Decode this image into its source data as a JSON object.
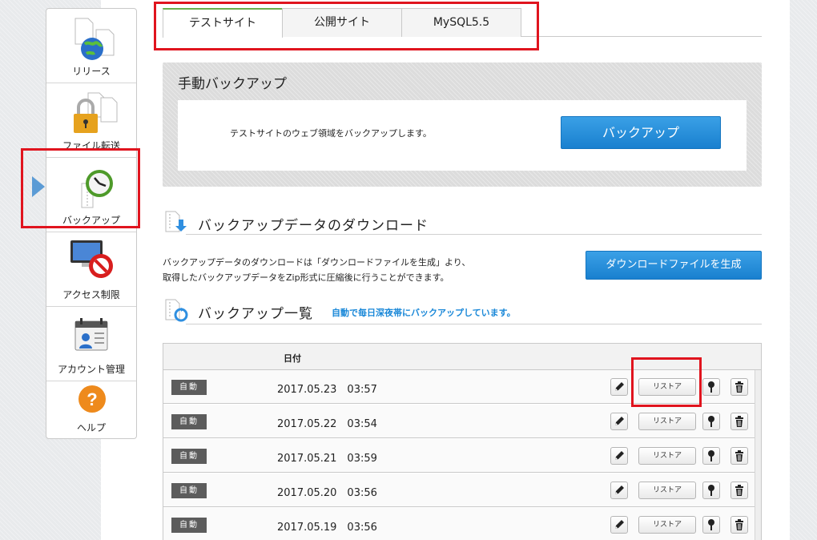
{
  "sidebar": {
    "items": [
      {
        "label": "リリース",
        "icon": "release-globe-icon"
      },
      {
        "label": "ファイル転送",
        "icon": "lock-files-icon"
      },
      {
        "label": "バックアップ",
        "icon": "clock-backup-icon"
      },
      {
        "label": "アクセス制限",
        "icon": "monitor-no-entry-icon"
      },
      {
        "label": "アカウント管理",
        "icon": "calendar-account-icon"
      },
      {
        "label": "ヘルプ",
        "icon": "help-question-icon"
      }
    ],
    "active": "バックアップ"
  },
  "tabs": [
    {
      "label": "テストサイト",
      "active": true
    },
    {
      "label": "公開サイト",
      "active": false
    },
    {
      "label": "MySQL5.5",
      "active": false
    }
  ],
  "manual": {
    "title": "手動バックアップ",
    "description": "テストサイトのウェブ領域をバックアップします。",
    "button": "バックアップ"
  },
  "download": {
    "title": "バックアップデータのダウンロード",
    "desc_line1": "バックアップデータのダウンロードは「ダウンロードファイルを生成」より、",
    "desc_line2": "取得したバックアップデータをZip形式に圧縮後に行うことができます。",
    "button": "ダウンロードファイルを生成"
  },
  "list": {
    "title": "バックアップ一覧",
    "note": "自動で毎日深夜帯にバックアップしています。",
    "header_date": "日付",
    "restore_label": "リストア",
    "rows": [
      {
        "type": "自動",
        "date": "2017.05.23　03:57"
      },
      {
        "type": "自動",
        "date": "2017.05.22　03:54"
      },
      {
        "type": "自動",
        "date": "2017.05.21　03:59"
      },
      {
        "type": "自動",
        "date": "2017.05.20　03:56"
      },
      {
        "type": "自動",
        "date": "2017.05.19　03:56"
      }
    ]
  },
  "colors": {
    "accent_blue": "#1a88d8",
    "highlight_red": "#e0141e",
    "tab_active_green": "#6ab04c"
  }
}
